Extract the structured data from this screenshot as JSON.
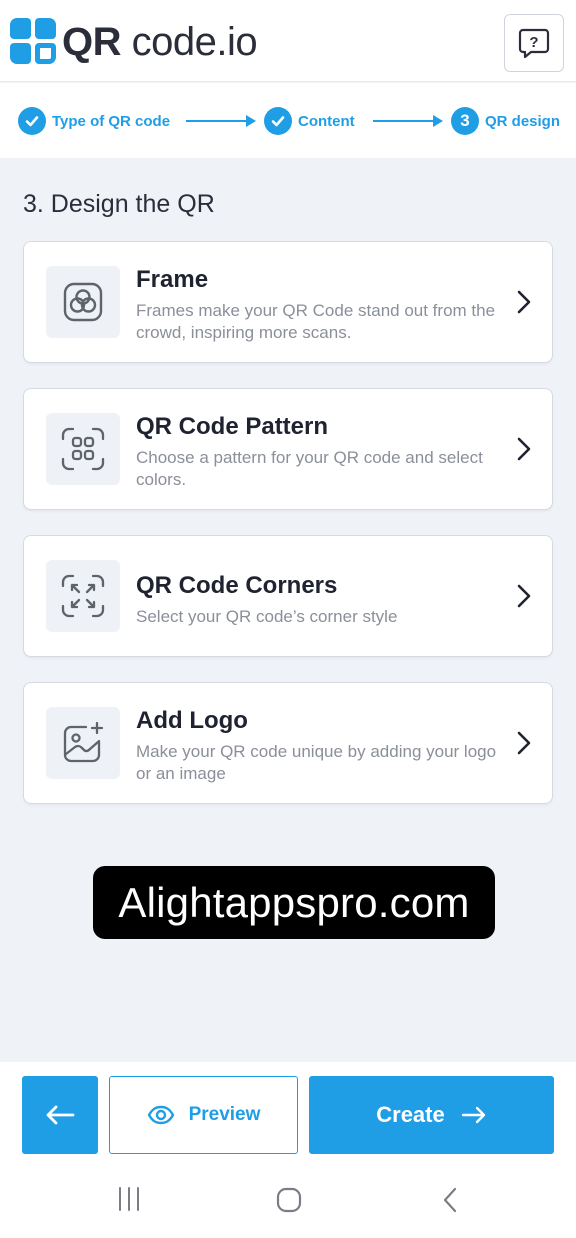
{
  "header": {
    "logo_bold": "QR",
    "logo_rest": " code.io",
    "help_icon": "help-chat-icon"
  },
  "stepper": {
    "steps": [
      {
        "marker": "check",
        "label": "Type of QR code"
      },
      {
        "marker": "check",
        "label": "Content"
      },
      {
        "marker": "3",
        "label": "QR design"
      }
    ]
  },
  "main": {
    "title": "3. Design the QR",
    "cards": [
      {
        "title": "Frame",
        "description": "Frames make your QR Code stand out from the crowd, inspiring more scans.",
        "icon": "frame-icon"
      },
      {
        "title": "QR Code Pattern",
        "description": "Choose a pattern for your QR code and select colors.",
        "icon": "pattern-icon"
      },
      {
        "title": "QR Code Corners",
        "description": "Select your QR code’s corner style",
        "icon": "corners-icon"
      },
      {
        "title": "Add Logo",
        "description": "Make your QR code unique by adding your logo or an image",
        "icon": "add-image-icon"
      }
    ]
  },
  "watermark": "Alightappspro.com",
  "footer": {
    "preview_label": "Preview",
    "create_label": "Create"
  },
  "colors": {
    "accent": "#1f9ee6",
    "background": "#eff3f8",
    "text": "#1f2230",
    "muted": "#8a8f99"
  }
}
